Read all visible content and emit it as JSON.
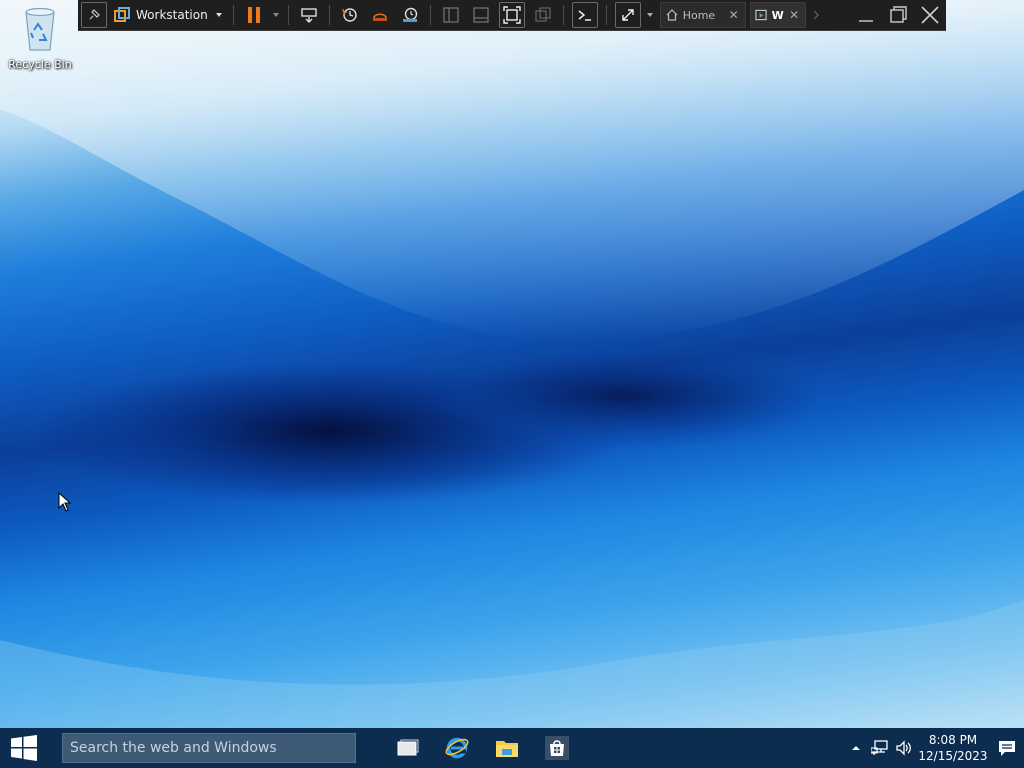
{
  "desktop": {
    "icons": [
      {
        "label": "Recycle Bin",
        "icon": "recycle-bin-icon"
      }
    ]
  },
  "vm_toolbar": {
    "menu_label": "Workstation",
    "tabs": [
      {
        "label": "Home",
        "icon": "home-icon",
        "active": false
      },
      {
        "label": "W",
        "icon": "vm-icon",
        "active": true
      }
    ],
    "accent_pause": "#f07b1d"
  },
  "taskbar": {
    "search_placeholder": "Search the web and Windows",
    "apps": [
      "task-view-icon",
      "internet-explorer-icon",
      "file-explorer-icon",
      "store-icon"
    ],
    "clock": {
      "time": "8:08 PM",
      "date": "12/15/2023"
    },
    "colors": {
      "taskbar_bg": "#0c2d4f",
      "search_bg": "#3f5a77"
    }
  }
}
